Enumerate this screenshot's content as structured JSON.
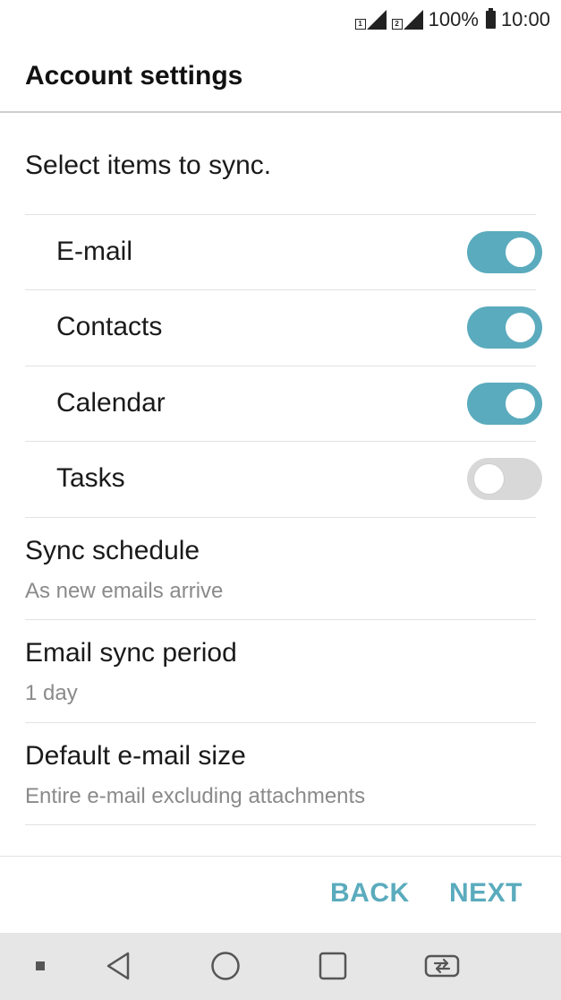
{
  "status_bar": {
    "sim1_label": "1",
    "sim2_label": "2",
    "battery_percent": "100%",
    "time": "10:00"
  },
  "header": {
    "title": "Account settings"
  },
  "sync": {
    "section_label": "Select items to sync.",
    "items": [
      {
        "label": "E-mail",
        "enabled": true
      },
      {
        "label": "Contacts",
        "enabled": true
      },
      {
        "label": "Calendar",
        "enabled": true
      },
      {
        "label": "Tasks",
        "enabled": false
      }
    ]
  },
  "preferences": [
    {
      "title": "Sync schedule",
      "value": "As new emails arrive"
    },
    {
      "title": "Email sync period",
      "value": "1 day"
    },
    {
      "title": "Default e-mail size",
      "value": "Entire e-mail excluding attachments"
    }
  ],
  "buttons": {
    "back_label": "BACK",
    "next_label": "NEXT"
  },
  "colors": {
    "accent": "#5aabbd",
    "toggle_off": "#d8d8d8",
    "nav_bar": "#e6e6e6"
  },
  "nav_bar": {
    "icons": [
      "small-square-icon",
      "back-icon",
      "home-icon",
      "recents-icon",
      "dual-window-icon"
    ]
  }
}
